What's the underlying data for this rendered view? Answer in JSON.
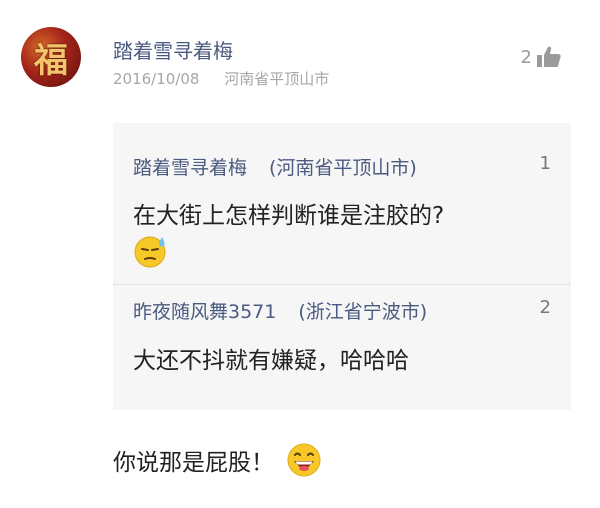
{
  "comment": {
    "user": "踏着雪寻着梅",
    "date": "2016/10/08",
    "location": "河南省平顶山市",
    "like_count": "2",
    "text": "你说那是屁股！"
  },
  "quotes": [
    {
      "user": "踏着雪寻着梅",
      "location": "(河南省平顶山市)",
      "floor": "1",
      "text": "在大街上怎样判断谁是注胶的?"
    },
    {
      "user": "昨夜随风舞3571",
      "location": "(浙江省宁波市)",
      "floor": "2",
      "text": "大还不抖就有嫌疑，哈哈哈"
    }
  ],
  "icons": {
    "like": "thumbs-up-icon",
    "emoji_sweat": "sweat-emoji-icon",
    "emoji_grin": "grin-emoji-icon"
  },
  "colors": {
    "username": "#4b5a80",
    "meta": "#a6a6a6",
    "quote_bg": "#f6f6f6",
    "text": "#222222"
  }
}
